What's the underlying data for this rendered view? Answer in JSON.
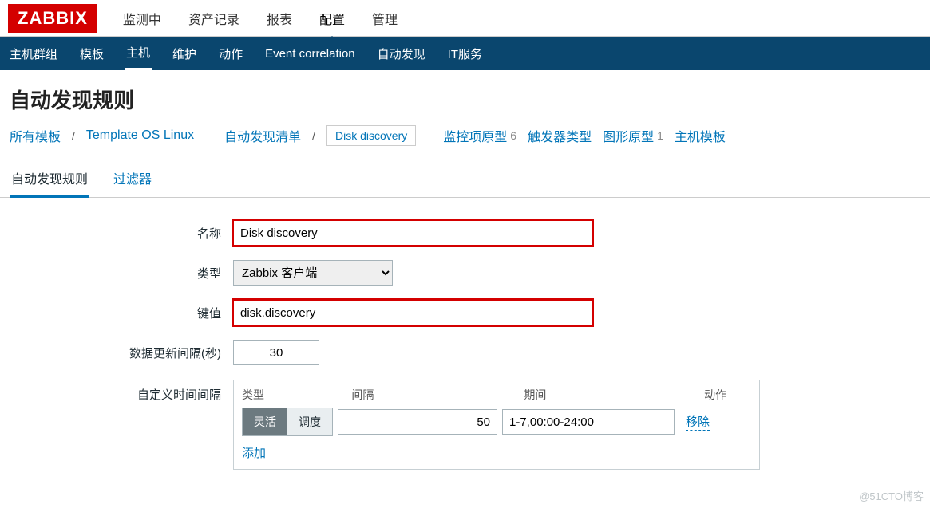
{
  "logo": "ZABBIX",
  "topmenu": {
    "items": [
      "监测中",
      "资产记录",
      "报表",
      "配置",
      "管理"
    ],
    "active_index": 3
  },
  "subnav": {
    "items": [
      "主机群组",
      "模板",
      "主机",
      "维护",
      "动作",
      "Event correlation",
      "自动发现",
      "IT服务"
    ],
    "active_index": 2
  },
  "page_title": "自动发现规则",
  "breadcrumb": {
    "all_templates": "所有模板",
    "template_name": "Template OS Linux",
    "discovery_list": "自动发现清单",
    "current_rule": "Disk discovery",
    "links": [
      {
        "label": "监控项原型",
        "count": "6"
      },
      {
        "label": "触发器类型",
        "count": ""
      },
      {
        "label": "图形原型",
        "count": "1"
      },
      {
        "label": "主机模板",
        "count": ""
      }
    ]
  },
  "tabs": {
    "items": [
      "自动发现规则",
      "过滤器"
    ],
    "active_index": 0
  },
  "form": {
    "name_label": "名称",
    "name_value": "Disk discovery",
    "type_label": "类型",
    "type_value": "Zabbix 客户端",
    "key_label": "键值",
    "key_value": "disk.discovery",
    "interval_label": "数据更新间隔(秒)",
    "interval_value": "30",
    "custom_label": "自定义时间间隔",
    "intervals": {
      "hdr_type": "类型",
      "hdr_int": "间隔",
      "hdr_period": "期间",
      "hdr_action": "动作",
      "flex_label": "灵活",
      "sched_label": "调度",
      "val_int": "50",
      "val_period": "1-7,00:00-24:00",
      "remove": "移除",
      "add": "添加"
    }
  },
  "watermark": "@51CTO博客"
}
